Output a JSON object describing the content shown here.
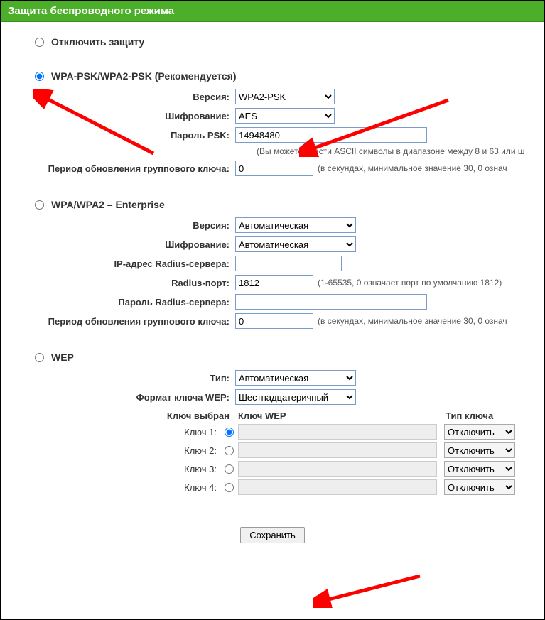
{
  "header": "Защита беспроводного режима",
  "disable": {
    "label": "Отключить защиту"
  },
  "psk": {
    "label": "WPA-PSK/WPA2-PSK (Рекомендуется)",
    "version_label": "Версия:",
    "version_value": "WPA2-PSK",
    "encryption_label": "Шифрование:",
    "encryption_value": "AES",
    "password_label": "Пароль PSK:",
    "password_value": "14948480",
    "password_hint": "(Вы можете ввести ASCII символы в диапазоне между 8 и 63 или ш",
    "group_key_label": "Период обновления группового ключа:",
    "group_key_value": "0",
    "group_key_hint": "(в секундах, минимальное значение 30, 0 означ"
  },
  "enterprise": {
    "label": "WPA/WPA2 – Enterprise",
    "version_label": "Версия:",
    "version_value": "Автоматическая",
    "encryption_label": "Шифрование:",
    "encryption_value": "Автоматическая",
    "radius_ip_label": "IP-адрес Radius-сервера:",
    "radius_ip_value": "",
    "radius_port_label": "Radius-порт:",
    "radius_port_value": "1812",
    "radius_port_hint": "(1-65535, 0 означает порт по умолчанию 1812)",
    "radius_pass_label": "Пароль Radius-сервера:",
    "radius_pass_value": "",
    "group_key_label": "Период обновления группового ключа:",
    "group_key_value": "0",
    "group_key_hint": "(в секундах, минимальное значение 30, 0 означ"
  },
  "wep": {
    "label": "WEP",
    "type_label": "Тип:",
    "type_value": "Автоматическая",
    "format_label": "Формат ключа WEP:",
    "format_value": "Шестнадцатеричный",
    "col_selected": "Ключ выбран",
    "col_key": "Ключ WEP",
    "col_type": "Тип ключа",
    "rows": [
      {
        "label": "Ключ 1:",
        "key": "",
        "type": "Отключить"
      },
      {
        "label": "Ключ 2:",
        "key": "",
        "type": "Отключить"
      },
      {
        "label": "Ключ 3:",
        "key": "",
        "type": "Отключить"
      },
      {
        "label": "Ключ 4:",
        "key": "",
        "type": "Отключить"
      }
    ]
  },
  "save_label": "Сохранить"
}
